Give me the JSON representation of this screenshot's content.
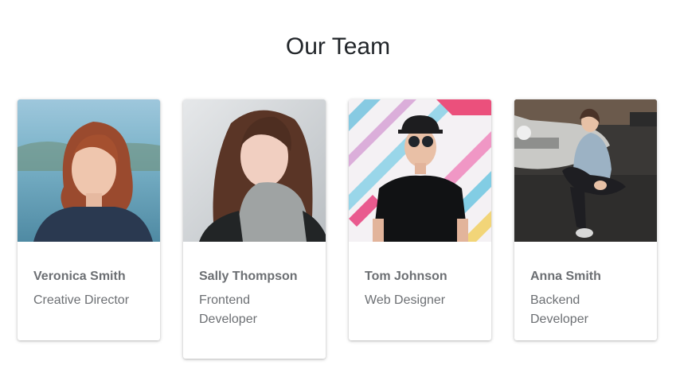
{
  "section": {
    "title": "Our Team"
  },
  "members": [
    {
      "name": "Veronica Smith",
      "role": "Creative Director"
    },
    {
      "name": "Sally Thompson",
      "role": "Frontend Developer"
    },
    {
      "name": "Tom Johnson",
      "role": "Web Designer"
    },
    {
      "name": "Anna Smith",
      "role": "Backend Developer"
    }
  ]
}
